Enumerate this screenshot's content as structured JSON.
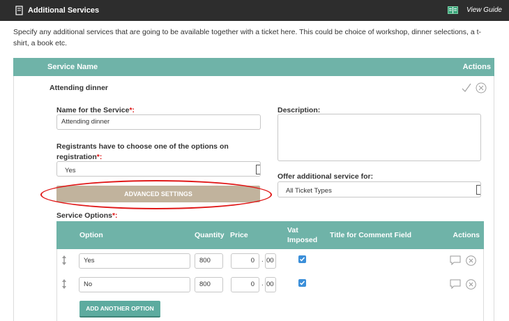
{
  "header": {
    "title": "Additional Services",
    "view_guide": "View Guide"
  },
  "intro_text": "Specify any additional services that are going to be available together with a ticket here. This could be choice of workshop, dinner selections, a t-shirt, a book etc.",
  "services_table": {
    "col_service_name": "Service Name",
    "col_actions": "Actions"
  },
  "service": {
    "row_name": "Attending dinner",
    "name_label": "Name for the Service",
    "name_required": "*:",
    "name_value": "Attending dinner",
    "description_label": "Description:",
    "description_value": "",
    "choose_label_line1": "Registrants have to choose one of the options on",
    "choose_label_line2": "registration",
    "choose_required": "*:",
    "choose_value": "Yes",
    "offer_label": "Offer additional service for:",
    "offer_value": "All Ticket Types",
    "advanced_settings": "ADVANCED SETTINGS",
    "options_label": "Service Options",
    "options_required": "*:"
  },
  "options_table": {
    "col_option": "Option",
    "col_quantity": "Quantity",
    "col_price": "Price",
    "col_vat_line1": "Vat",
    "col_vat_line2": "Imposed",
    "col_comment": "Title for Comment Field",
    "col_actions": "Actions",
    "rows": [
      {
        "option": "Yes",
        "quantity": "800",
        "price_whole": "0",
        "price_cents": "00",
        "vat": true
      },
      {
        "option": "No",
        "quantity": "800",
        "price_whole": "0",
        "price_cents": "00",
        "vat": true
      }
    ],
    "add_button": "ADD ANOTHER OPTION"
  },
  "colors": {
    "teal_header": "#6fb3a8",
    "topbar": "#2d2d2d",
    "advanced_button": "#c1b39d",
    "highlight_ellipse": "#e01818",
    "checkbox": "#3b8fd9"
  }
}
